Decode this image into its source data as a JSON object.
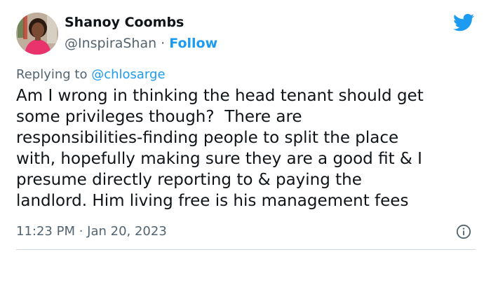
{
  "author": {
    "display_name": "Shanoy Coombs",
    "handle": "@InspiraShan",
    "separator": " · ",
    "follow_label": "Follow"
  },
  "reply": {
    "prefix": "Replying to ",
    "target": "@chlosarge"
  },
  "tweet": {
    "text": "Am I wrong in thinking the head tenant should get\nsome privileges though?  There are\nresponsibilities-finding people to split the place\nwith, hopefully making sure they are a good fit & I\npresume directly reporting to & paying the\nlandlord. Him living free is his management fees",
    "timestamp": "11:23 PM · Jan 20, 2023"
  },
  "icons": {
    "brand": "twitter-bird-icon",
    "info": "info-icon"
  },
  "colors": {
    "accent": "#1d9bf0",
    "text_primary": "#0f1419",
    "text_secondary": "#536471",
    "divider": "#cfd9de"
  }
}
